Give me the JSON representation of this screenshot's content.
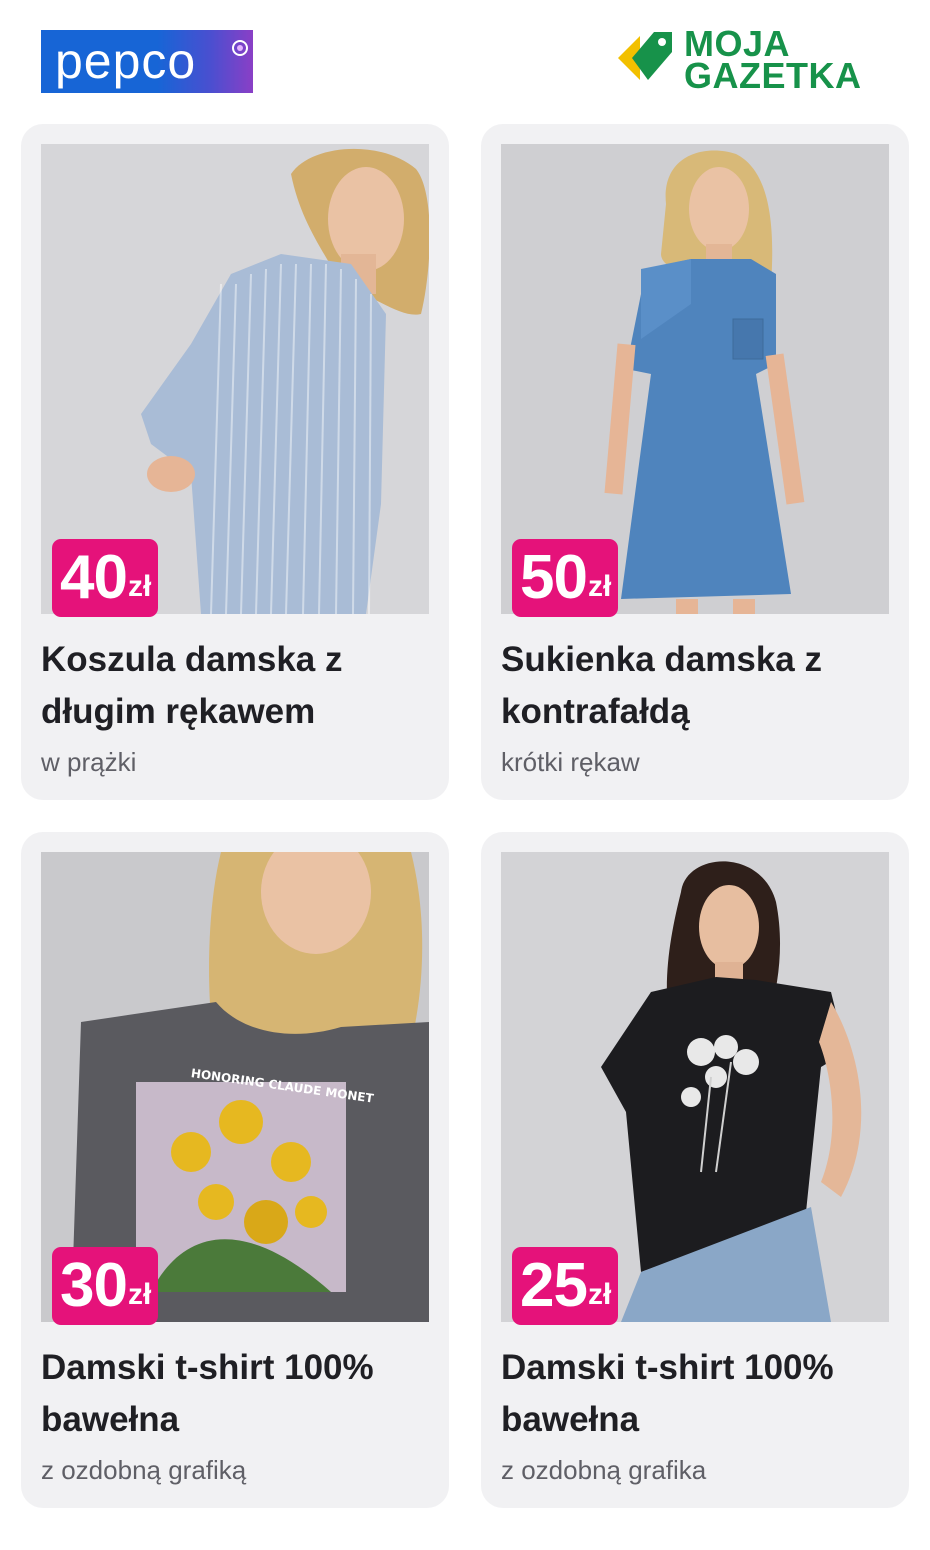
{
  "header": {
    "pepco_logo": "pepco",
    "moja_gazetka_line1": "MOJA",
    "moja_gazetka_line2": "GAZETKA",
    "brand_colors": {
      "pepco_blue": "#1765d6",
      "pepco_purple": "#8a3fc6",
      "moja_green": "#17924a",
      "moja_yellow": "#f2c000",
      "price_pink": "#e5127a"
    }
  },
  "products": [
    {
      "price": "40",
      "currency": "zł",
      "title": "Koszula damska z długim rękawem",
      "subtitle": "w prążki",
      "image_icon": "striped-shirt-photo"
    },
    {
      "price": "50",
      "currency": "zł",
      "title": "Sukienka damska z kontrafałdą",
      "subtitle": "krótki rękaw",
      "image_icon": "denim-dress-photo"
    },
    {
      "price": "30",
      "currency": "zł",
      "title": "Damski t-shirt 100% bawełna",
      "subtitle": "z ozdobną grafiką",
      "image_icon": "monet-tshirt-photo",
      "print_text": "HONORING CLAUDE MONET"
    },
    {
      "price": "25",
      "currency": "zł",
      "title": "Damski t-shirt 100% bawełna",
      "subtitle": "z ozdobną grafika",
      "image_icon": "black-tshirt-photo"
    }
  ]
}
